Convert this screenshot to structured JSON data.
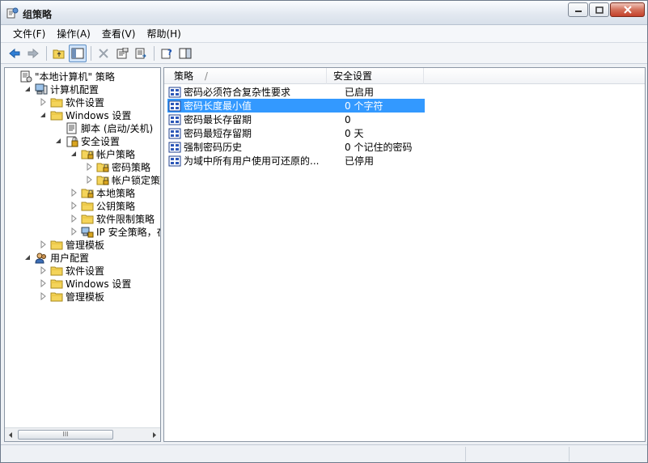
{
  "window": {
    "title": "组策略"
  },
  "menu": [
    "文件(F)",
    "操作(A)",
    "查看(V)",
    "帮助(H)"
  ],
  "toolbar": {
    "buttons": [
      "back-icon",
      "forward-icon",
      "up-folder-icon",
      "show-tree-icon",
      "delete-icon",
      "properties-icon",
      "export-list-icon",
      "help-icon",
      "show-pane-icon"
    ]
  },
  "tree": [
    {
      "label": "\"本地计算机\" 策略",
      "icon": "computer-policy-icon",
      "depth": 0,
      "expander": "none"
    },
    {
      "label": "计算机配置",
      "icon": "computer-icon",
      "depth": 1,
      "expander": "expanded"
    },
    {
      "label": "软件设置",
      "icon": "folder-icon",
      "depth": 2,
      "expander": "collapsed"
    },
    {
      "label": "Windows 设置",
      "icon": "folder-icon",
      "depth": 2,
      "expander": "expanded"
    },
    {
      "label": "脚本 (启动/关机)",
      "icon": "script-icon",
      "depth": 3,
      "expander": "none"
    },
    {
      "label": "安全设置",
      "icon": "security-icon",
      "depth": 3,
      "expander": "expanded"
    },
    {
      "label": "帐户策略",
      "icon": "lock-folder-icon",
      "depth": 4,
      "expander": "expanded"
    },
    {
      "label": "密码策略",
      "icon": "lock-folder-icon",
      "depth": 5,
      "expander": "collapsed"
    },
    {
      "label": "帐户锁定策略",
      "icon": "lock-folder-icon",
      "depth": 5,
      "expander": "collapsed"
    },
    {
      "label": "本地策略",
      "icon": "lock-folder-icon",
      "depth": 4,
      "expander": "collapsed"
    },
    {
      "label": "公钥策略",
      "icon": "folder-icon",
      "depth": 4,
      "expander": "collapsed"
    },
    {
      "label": "软件限制策略",
      "icon": "folder-icon",
      "depth": 4,
      "expander": "collapsed"
    },
    {
      "label": "IP 安全策略，在",
      "icon": "ip-security-icon",
      "depth": 4,
      "expander": "collapsed"
    },
    {
      "label": "管理模板",
      "icon": "folder-icon",
      "depth": 2,
      "expander": "collapsed"
    },
    {
      "label": "用户配置",
      "icon": "users-icon",
      "depth": 1,
      "expander": "expanded"
    },
    {
      "label": "软件设置",
      "icon": "folder-icon",
      "depth": 2,
      "expander": "collapsed"
    },
    {
      "label": "Windows 设置",
      "icon": "folder-icon",
      "depth": 2,
      "expander": "collapsed"
    },
    {
      "label": "管理模板",
      "icon": "folder-icon",
      "depth": 2,
      "expander": "collapsed"
    }
  ],
  "list": {
    "columns": [
      "策略",
      "安全设置"
    ],
    "sort_indicator": "/",
    "rows": [
      {
        "name": "密码必须符合复杂性要求",
        "value": "已启用",
        "selected": false
      },
      {
        "name": "密码长度最小值",
        "value": "0 个字符",
        "selected": true
      },
      {
        "name": "密码最长存留期",
        "value": "0",
        "selected": false
      },
      {
        "name": "密码最短存留期",
        "value": "0 天",
        "selected": false
      },
      {
        "name": "强制密码历史",
        "value": "0 个记住的密码",
        "selected": false
      },
      {
        "name": "为域中所有用户使用可还原的...",
        "value": "已停用",
        "selected": false
      }
    ]
  },
  "scrollbar": {
    "thumb_grip": "III"
  },
  "colors": {
    "selection": "#3399ff",
    "folder": "#f4d45a"
  }
}
